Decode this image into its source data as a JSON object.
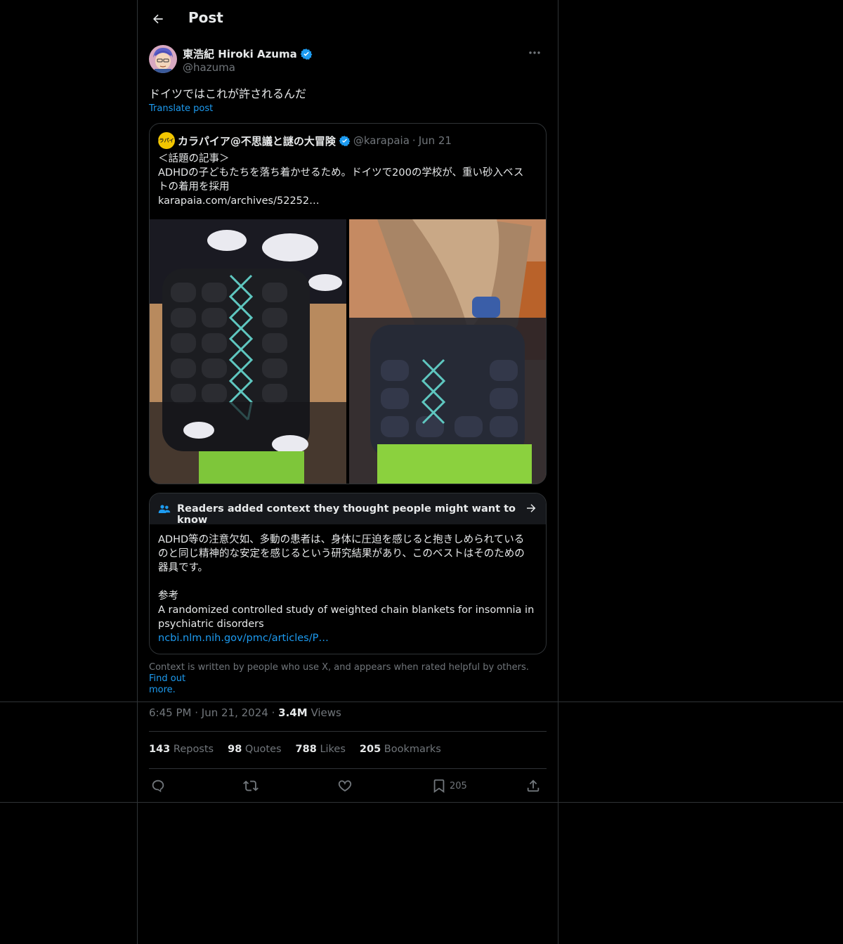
{
  "header": {
    "title": "Post"
  },
  "author": {
    "name": "東浩紀 Hiroki Azuma",
    "handle": "@hazuma",
    "verified": true
  },
  "post": {
    "text": "ドイツではこれが許されるんだ",
    "translate_label": "Translate post"
  },
  "quote": {
    "avatar_text": "カラパイア",
    "name": "カラパイア@不思議と謎の大冒険",
    "handle": "@karapaia",
    "separator": "·",
    "date": "Jun 21",
    "lines": [
      "＜話題の記事＞",
      "ADHDの子どもたちを落ち着かせるため。ドイツで200の学校が、重い砂入ベス",
      "トの着用を採用",
      "karapaia.com/archives/52252…"
    ]
  },
  "community_note": {
    "heading": "Readers added context they thought people might want to know",
    "body_lines": [
      "ADHD等の注意欠如、多動の患者は、身体に圧迫を感じると抱きしめられている",
      "のと同じ精神的な安定を感じるという研究結果があり、このベストはそのための",
      "器具です。",
      "",
      "参考",
      "A randomized controlled study of weighted chain blankets for insomnia in",
      "psychiatric disorders"
    ],
    "link": "ncbi.nlm.nih.gov/pmc/articles/P…",
    "footer_text": "Context is written by people who use X, and appears when rated helpful by others.",
    "footer_link_1": "Find out",
    "footer_link_2": "more."
  },
  "meta": {
    "time": "6:45 PM",
    "sep1": "·",
    "date": "Jun 21, 2024",
    "sep2": "·",
    "views_count": "3.4M",
    "views_label": "Views"
  },
  "stats": [
    {
      "count": "143",
      "label": "Reposts"
    },
    {
      "count": "98",
      "label": "Quotes"
    },
    {
      "count": "788",
      "label": "Likes"
    },
    {
      "count": "205",
      "label": "Bookmarks"
    }
  ],
  "actions": {
    "reply_icon": "reply-icon",
    "repost_icon": "repost-icon",
    "like_icon": "heart-icon",
    "bookmark_icon": "bookmark-icon",
    "bookmark_count": "205",
    "share_icon": "share-icon"
  },
  "colors": {
    "background": "#000000",
    "text": "#e7e9ea",
    "muted": "#71767b",
    "accent": "#1d9bf0",
    "border": "#2f3336"
  }
}
